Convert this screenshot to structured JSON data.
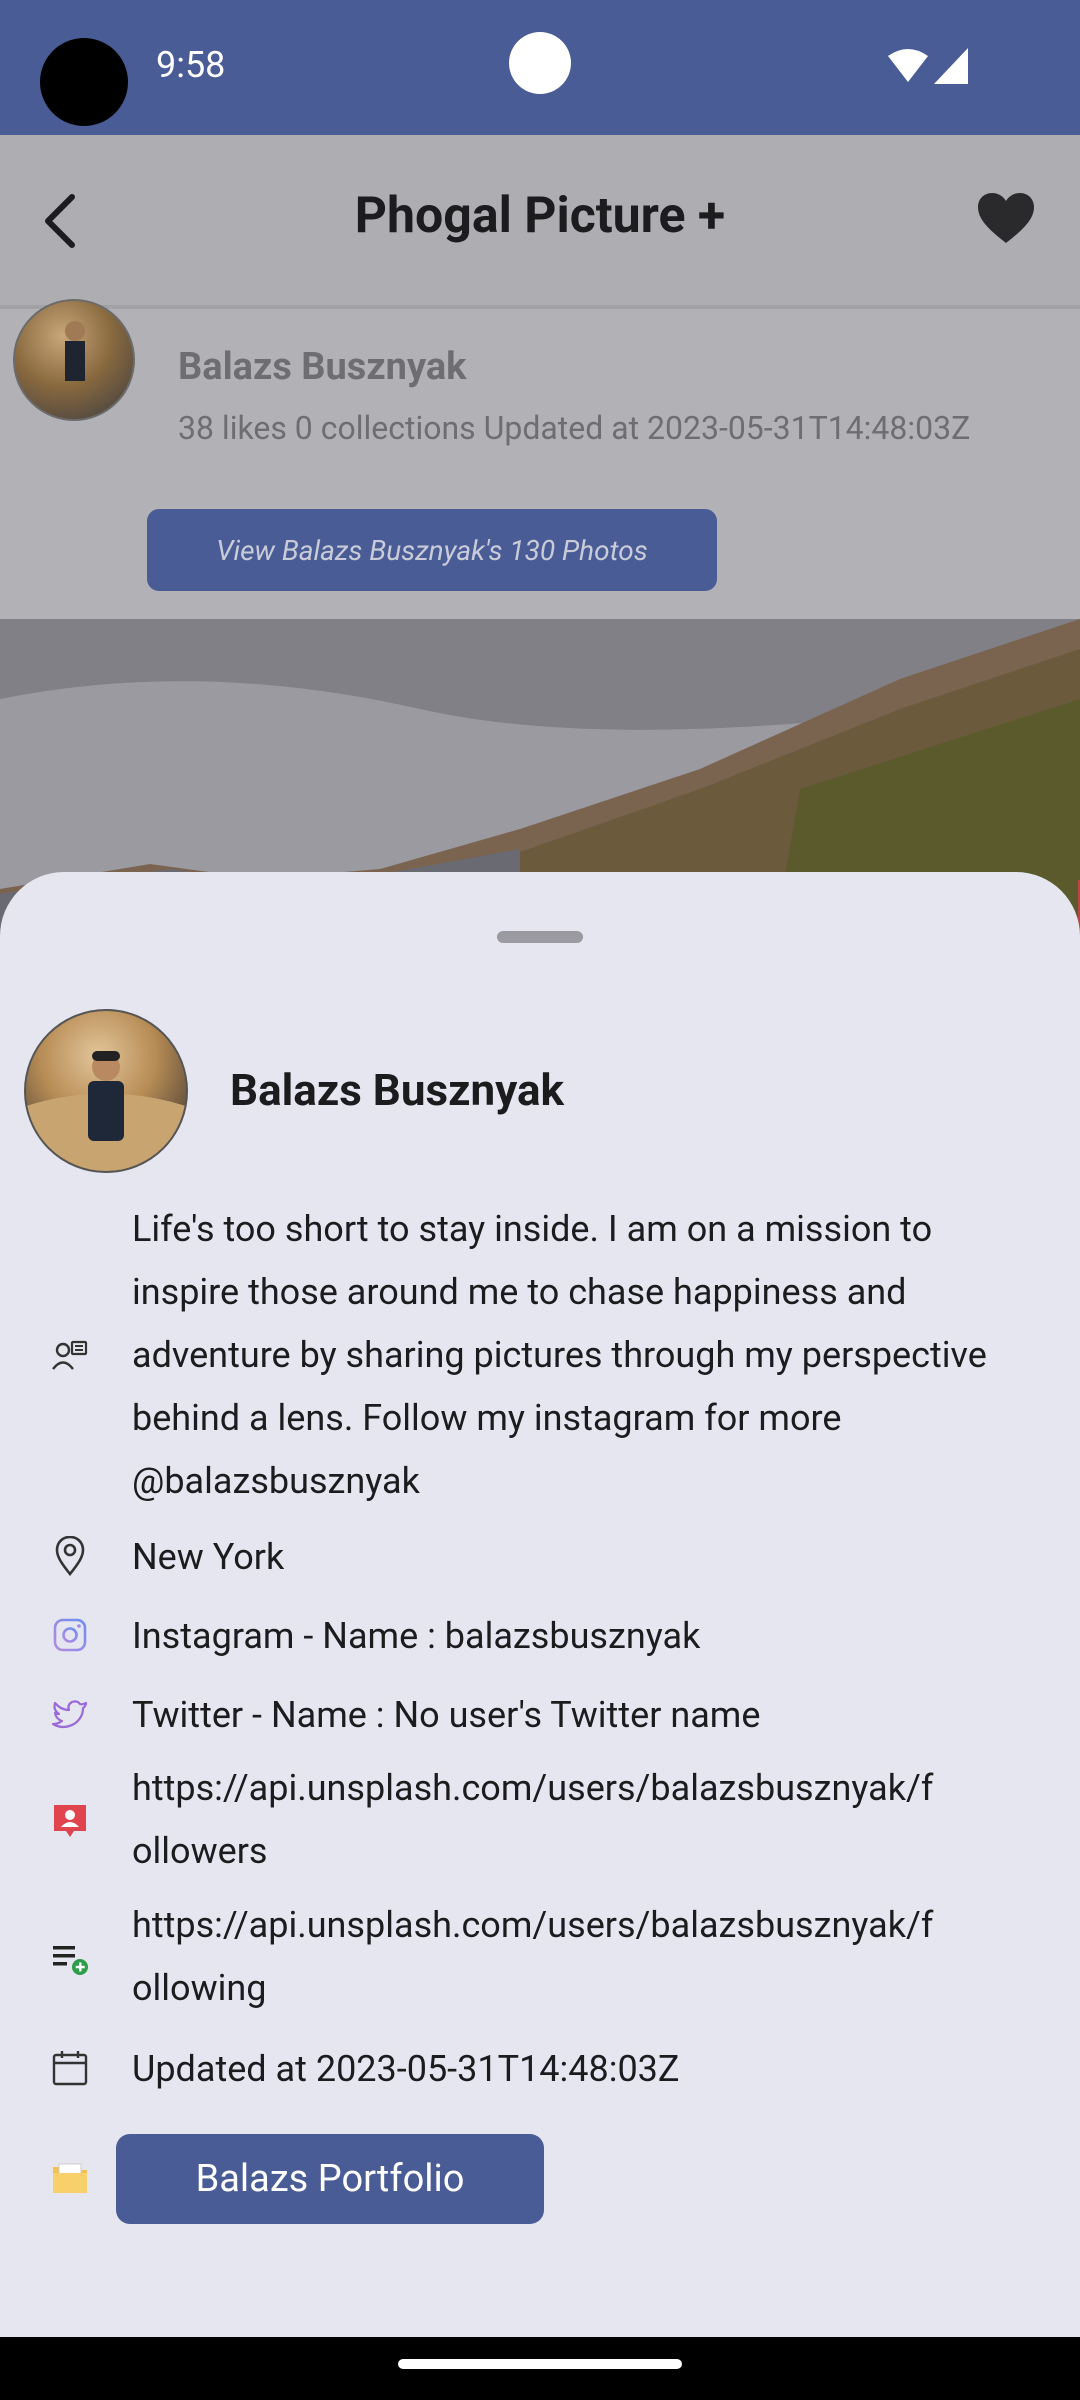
{
  "status_bar": {
    "time": "9:58"
  },
  "app_bar": {
    "title": "Phogal Picture +"
  },
  "author_card": {
    "name": "Balazs Busznyak",
    "stats": "38 likes 0 collections Updated at 2023-05-31T14:48:03Z",
    "view_photos_label": "View Balazs Busznyak's 130 Photos"
  },
  "profile_sheet": {
    "name": "Balazs Busznyak",
    "bio": "Life's too short to stay inside. I am on a mission to inspire those around me to chase happiness and adventure by sharing pictures through my perspective behind a lens. Follow my instagram for more @balazsbusznyak",
    "location": "New York",
    "instagram": "Instagram - Name : balazsbusznyak",
    "twitter": "Twitter - Name : No user's Twitter name",
    "followers_url": "https://api.unsplash.com/users/balazsbusznyak/followers",
    "following_url": "https://api.unsplash.com/users/balazsbusznyak/following",
    "updated": "Updated at 2023-05-31T14:48:03Z",
    "portfolio_label": "Balazs Portfolio"
  },
  "colors": {
    "primary": "#4a5c96",
    "sheet_bg": "#e6e6f0"
  }
}
